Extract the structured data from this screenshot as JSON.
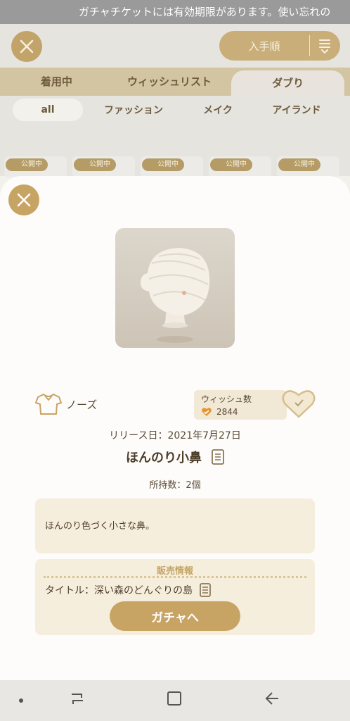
{
  "ticker": {
    "text": "ガチャチケットには有効期限があります。使い忘れの"
  },
  "header": {
    "sort_label": "入手順"
  },
  "main_tabs": [
    {
      "label": "着用中"
    },
    {
      "label": "ウィッシュリスト"
    },
    {
      "label": "ダブり"
    }
  ],
  "sub_tabs": [
    {
      "label": "all"
    },
    {
      "label": "ファッション"
    },
    {
      "label": "メイク"
    },
    {
      "label": "アイランド"
    }
  ],
  "thumbs": [
    {
      "badge": "公開中"
    },
    {
      "badge": "公開中"
    },
    {
      "badge": "公開中"
    },
    {
      "badge": "公開中"
    },
    {
      "badge": "公開中"
    }
  ],
  "item": {
    "category": "ノーズ",
    "wish_label": "ウィッシュ数",
    "wish_count": "2844",
    "release": "リリース日：2021年7月27日",
    "name": "ほんのり小鼻",
    "owned": "所持数：2個",
    "description": "ほんのり色づく小さな鼻。"
  },
  "sale": {
    "heading": "販売情報",
    "title": "タイトル：深い森のどんぐりの島",
    "button": "ガチャへ"
  },
  "colors": {
    "accent": "#c8a464",
    "panel": "#f6eedd"
  }
}
